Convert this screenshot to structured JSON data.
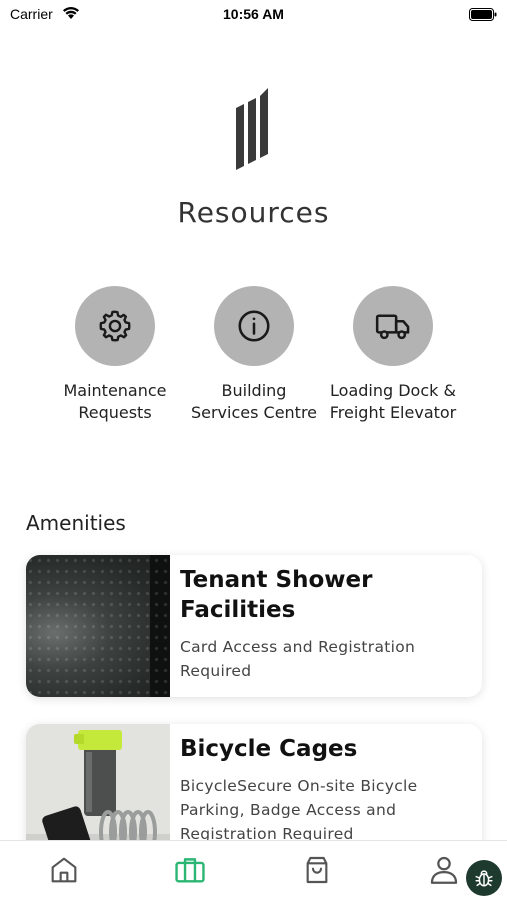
{
  "status_bar": {
    "carrier": "Carrier",
    "time": "10:56 AM"
  },
  "header": {
    "title": "Resources",
    "logo_icon": "striped-bars-logo"
  },
  "quick_actions": [
    {
      "label_line1": "Maintenance",
      "label_line2": "Requests",
      "icon": "gear-icon"
    },
    {
      "label_line1": "Building",
      "label_line2": "Services Centre",
      "icon": "info-icon"
    },
    {
      "label_line1": "Loading Dock &",
      "label_line2": "Freight Elevator",
      "icon": "truck-icon"
    }
  ],
  "amenities": {
    "section_title": "Amenities",
    "items": [
      {
        "title_line1": "Tenant Shower",
        "title_line2": "Facilities",
        "desc_line1": "Card Access and Registration",
        "desc_line2": "Required",
        "image": "wet-glass-photo"
      },
      {
        "title_line1": "Bicycle Cages",
        "desc_line1": "BicycleSecure On-site Bicycle",
        "desc_line2": "Parking, Badge Access and",
        "desc_line3": "Registration Required",
        "image": "bicycle-lock-photo"
      }
    ]
  },
  "tab_bar": {
    "items": [
      {
        "name": "home",
        "icon": "home-icon",
        "active": false
      },
      {
        "name": "resources",
        "icon": "briefcase-icon",
        "active": true
      },
      {
        "name": "shop",
        "icon": "shopping-bag-icon",
        "active": false
      },
      {
        "name": "profile",
        "icon": "person-icon",
        "active": false
      }
    ],
    "active_color": "#2bb673",
    "inactive_color": "#555555"
  },
  "debug_button": {
    "icon": "bug-icon"
  },
  "colors": {
    "action_circle": "#b3b3b3",
    "accent": "#2bb673",
    "debug_bg": "#1e3a2f"
  }
}
